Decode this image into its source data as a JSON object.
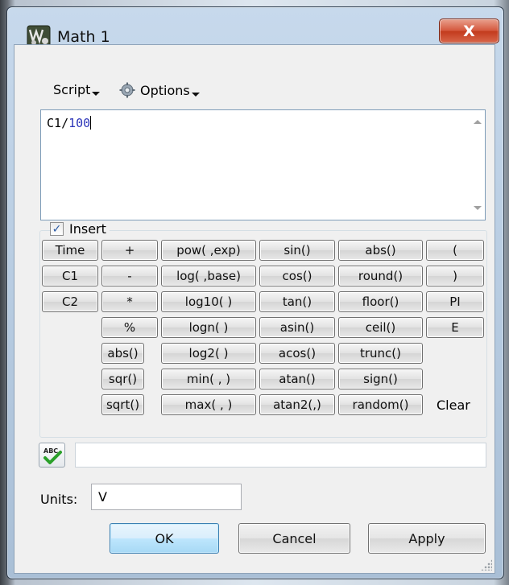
{
  "window": {
    "title": "Math 1",
    "close_label": "X",
    "accent": "#c23a1c"
  },
  "menu": {
    "script_label": "Script",
    "options_label": "Options"
  },
  "editor": {
    "variable": "C1",
    "operator": "/",
    "number": "100"
  },
  "insert": {
    "label": "Insert",
    "checked": true,
    "buttons_col1": [
      "Time",
      "C1",
      "C2"
    ],
    "buttons_col2": [
      "+",
      "-",
      "*",
      "%",
      "abs()",
      "sqr()",
      "sqrt()"
    ],
    "buttons_col3": [
      "pow( ,exp)",
      "log( ,base)",
      "log10( )",
      "logn( )",
      "log2( )",
      "min( , )",
      "max( , )"
    ],
    "buttons_col4": [
      "sin()",
      "cos()",
      "tan()",
      "asin()",
      "acos()",
      "atan()",
      "atan2(,)"
    ],
    "buttons_col5": [
      "abs()",
      "round()",
      "floor()",
      "ceil()",
      "trunc()",
      "sign()",
      "random()"
    ],
    "buttons_col6": [
      "(",
      ")",
      "PI",
      "E"
    ],
    "clear_label": "Clear"
  },
  "spellcheck": {
    "icon": "abc-check-icon",
    "value": ""
  },
  "units": {
    "label": "Units:",
    "value": "V"
  },
  "buttons": {
    "ok": "OK",
    "cancel": "Cancel",
    "apply": "Apply"
  }
}
